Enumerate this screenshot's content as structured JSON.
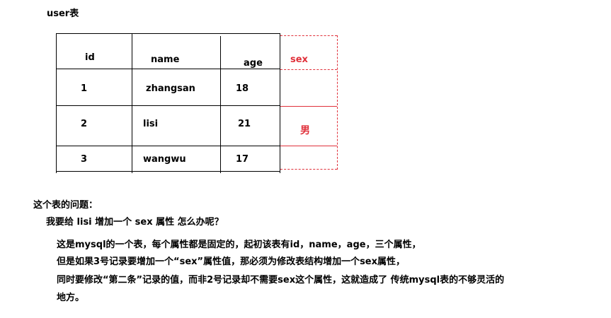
{
  "heading": "user表",
  "table": {
    "columns": [
      "id",
      "name",
      "age"
    ],
    "extra_column": "sex",
    "extra_value": "男",
    "rows": [
      {
        "id": "1",
        "name": "zhangsan",
        "age": "18"
      },
      {
        "id": "2",
        "name": "lisi",
        "age": "21"
      },
      {
        "id": "3",
        "name": "wangwu",
        "age": "17"
      }
    ]
  },
  "problem_title": "这个表的问题：",
  "question": "我要给 lisi  增加一个  sex 属性   怎么办呢？",
  "explanation": [
    "这是mysql的一个表，每个属性都是固定的，起初该表有id，name，age，三个属性，",
    "但是如果3号记录要增加一个“sex”属性值，那必须为修改表结构增加一个sex属性，",
    "同时要修改“第二条”记录的值，而非2号记录却不需要sex这个属性，这就造成了 传统mysql表的不够灵活的",
    "地方。"
  ],
  "colors": {
    "accent": "#e0303a",
    "text": "#000000",
    "background": "#ffffff"
  }
}
